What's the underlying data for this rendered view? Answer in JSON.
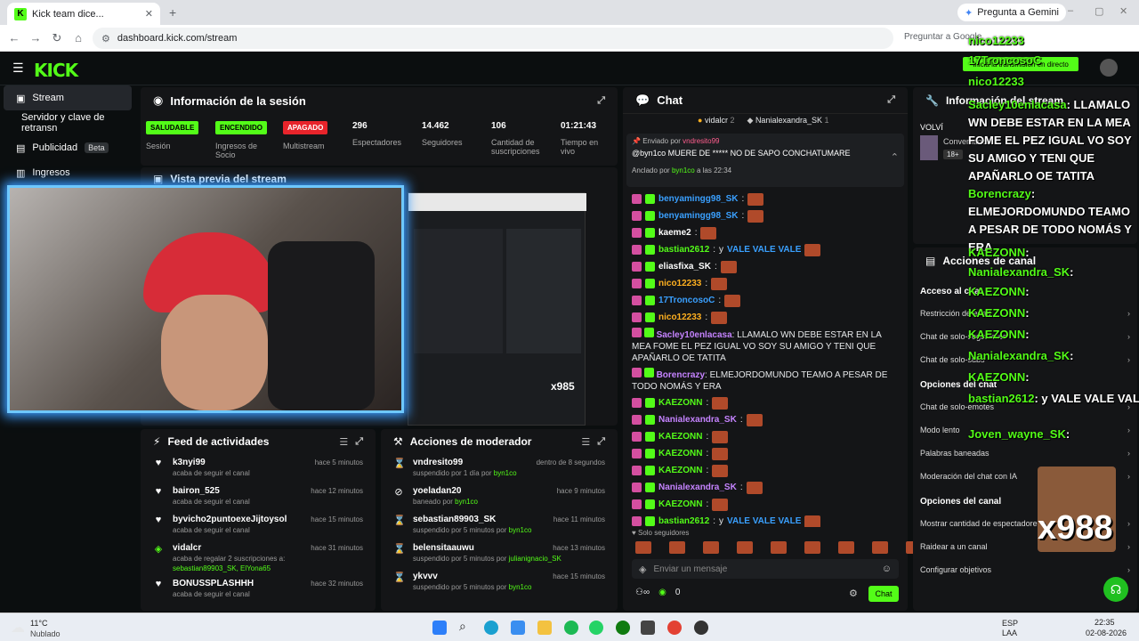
{
  "browser": {
    "tab_title": "Kick team dice...",
    "gemini": "Pregunta a Gemini",
    "url": "dashboard.kick.com/stream",
    "ask_google": "Preguntar a Google"
  },
  "sidebar": {
    "items": [
      {
        "label": "Stream"
      },
      {
        "label": "Servidor y clave de retransn"
      },
      {
        "label": "Publicidad",
        "badge": "Beta"
      },
      {
        "label": "Ingresos"
      }
    ]
  },
  "session": {
    "title": "Información de la sesión",
    "stats": [
      {
        "badge": "SALUDABLE",
        "label": "Sesión"
      },
      {
        "badge": "ENCENDIDO",
        "label": "Ingresos de Socio"
      },
      {
        "badge": "APAGADO",
        "label": "Multistream"
      },
      {
        "value": "296",
        "label": "Espectadores"
      },
      {
        "value": "14.462",
        "label": "Seguidores"
      },
      {
        "value": "106",
        "label": "Cantidad de suscripciones"
      },
      {
        "value": "01:21:43",
        "label": "Tiempo en vivo"
      }
    ]
  },
  "preview": {
    "title": "Vista previa del stream"
  },
  "feed": {
    "title": "Feed de actividades",
    "rows": [
      {
        "name": "k3nyi99",
        "sub": "acaba de seguir el canal",
        "time": "hace 5 minutos"
      },
      {
        "name": "bairon_525",
        "sub": "acaba de seguir el canal",
        "time": "hace 12 minutos"
      },
      {
        "name": "byvicho2puntoexeJijtoysol",
        "sub": "acaba de seguir el canal",
        "time": "hace 15 minutos"
      },
      {
        "name": "vidalcr",
        "sub": "acaba de regalar 2 suscripciones a:",
        "sub2": "sebastian89903_SK, ElYona65",
        "time": "hace 31 minutos"
      },
      {
        "name": "BONUSSPLASHHH",
        "sub": "acaba de seguir el canal",
        "time": "hace 32 minutos"
      }
    ]
  },
  "mod": {
    "title": "Acciones de moderador",
    "rows": [
      {
        "name": "vndresito99",
        "sub": "suspendido por 1 día por",
        "by": "byn1co",
        "time": "dentro de 8 segundos"
      },
      {
        "name": "yoeladan20",
        "sub": "baneado por",
        "by": "byn1co",
        "time": "hace 9 minutos"
      },
      {
        "name": "sebastian89903_SK",
        "sub": "suspendido por 5 minutos por",
        "by": "byn1co",
        "time": "hace 11 minutos"
      },
      {
        "name": "belensitaauwu",
        "sub": "suspendido por 5 minutos por",
        "by": "julianignacio_SK",
        "time": "hace 13 minutos"
      },
      {
        "name": "ykvvv",
        "sub": "suspendido por 5 minutos por",
        "by": "byn1co",
        "time": "hace 15 minutos"
      }
    ]
  },
  "chat": {
    "title": "Chat",
    "top_gifters": [
      {
        "name": "vidalcr",
        "count": "2"
      },
      {
        "name": "Nanialexandra_SK",
        "count": "1"
      }
    ],
    "pinned_by_label": "Enviado por",
    "pinned_by": "vndresito99",
    "pinned_msg": "@byn1co MUERE DE ***** NO DE SAPO CONCHATUMARE",
    "anchored_label": "Anclado por",
    "anchored_by": "byn1co",
    "anchored_time": "a las 22:34",
    "messages": [
      {
        "user": "benyamingg98_SK",
        "text": "",
        "color": "#3aa0ff"
      },
      {
        "user": "benyamingg98_SK",
        "text": "",
        "color": "#3aa0ff"
      },
      {
        "user": "kaeme2",
        "text": "",
        "color": "#ffffff"
      },
      {
        "user": "bastian2612",
        "text": "y",
        "vale": "VALE VALE VALE",
        "color": "#53fc18"
      },
      {
        "user": "eliasfixa_SK",
        "text": "",
        "color": "#ffffff"
      },
      {
        "user": "nico12233",
        "text": "",
        "color": "#ffb020"
      },
      {
        "user": "17TroncosoC",
        "text": "",
        "color": "#3aa0ff"
      },
      {
        "user": "nico12233",
        "text": "",
        "color": "#ffb020"
      },
      {
        "user": "Sacley10enlacasa",
        "text": "LLAMALO WN DEBE ESTAR EN LA MEA FOME EL PEZ IGUAL VO SOY SU AMIGO Y TENI QUE APAÑARLO OE TATITA",
        "color": "#c583ff"
      },
      {
        "user": "Borencrazy",
        "text": "ELMEJORDOMUNDO TEAMO A PESAR DE TODO NOMÁS Y ERA",
        "color": "#c583ff"
      },
      {
        "user": "KAEZONN",
        "text": "",
        "color": "#53fc18"
      },
      {
        "user": "Nanialexandra_SK",
        "text": "",
        "color": "#c583ff"
      },
      {
        "user": "KAEZONN",
        "text": "",
        "color": "#53fc18"
      },
      {
        "user": "KAEZONN",
        "text": "",
        "color": "#53fc18"
      },
      {
        "user": "KAEZONN",
        "text": "",
        "color": "#53fc18"
      },
      {
        "user": "Nanialexandra_SK",
        "text": "",
        "color": "#c583ff"
      },
      {
        "user": "KAEZONN",
        "text": "",
        "color": "#53fc18"
      },
      {
        "user": "bastian2612",
        "text": "y",
        "vale": "VALE VALE VALE",
        "color": "#53fc18"
      }
    ],
    "followers_only": "Solo seguidores",
    "input_placeholder": "Enviar un mensaje",
    "send_label": "Chat",
    "points": "0"
  },
  "stream_info": {
    "title": "Información del stream",
    "label": "VOLVÍ",
    "sub": "Conversando",
    "age": "18+"
  },
  "channel_actions": {
    "title": "Acciones de canal",
    "sections": [
      {
        "header": "Acceso al chat",
        "items": [
          "Restricción de edad",
          "Chat de solo-seguidores",
          "Chat de solo-subs"
        ]
      },
      {
        "header": "Opciones del chat",
        "items": [
          "Chat de solo-emotes",
          "Modo lento",
          "Palabras baneadas",
          "Moderación del chat con IA"
        ]
      },
      {
        "header": "Opciones del canal",
        "items": [
          "Mostrar cantidad de espectadores",
          "Raidear a un canal",
          "Configurar objetivos"
        ]
      }
    ]
  },
  "overlay": {
    "lines": [
      {
        "u": "nico12233",
        "m": ""
      },
      {
        "u": "17TroncosoC",
        "m": ""
      },
      {
        "u": "nico12233",
        "m": ""
      },
      {
        "u": "Sacley10enlacasa",
        "m": ": LLAMALO WN DEBE ESTAR EN LA MEA FOME EL PEZ IGUAL VO SOY SU AMIGO Y TENI QUE APAÑARLO OE TATITA"
      },
      {
        "u": "Borencrazy",
        "m": ": ELMEJORDOMUNDO TEAMO A PESAR DE TODO NOMÁS Y ERA"
      },
      {
        "u": "KAEZONN",
        "m": ":"
      },
      {
        "u": "Nanialexandra_SK",
        "m": ":"
      },
      {
        "u": "KAEZONN",
        "m": ":"
      },
      {
        "u": "KAEZONN",
        "m": ":"
      },
      {
        "u": "KAEZONN",
        "m": ":"
      },
      {
        "u": "Nanialexandra_SK",
        "m": ":"
      },
      {
        "u": "KAEZONN",
        "m": ":"
      },
      {
        "u": "bastian2612",
        "m": ": y VALE VALE VALE"
      },
      {
        "u": "Joven_wayne_SK",
        "m": ":"
      }
    ],
    "start_banner": "Inicia la transmisión en directo",
    "x_count": "x988",
    "cam_x": "x985"
  },
  "weather": {
    "temp": "11°C",
    "desc": "Nublado"
  },
  "clock": {
    "time": "22:35",
    "date": "02-08-2026",
    "lang": "ESP",
    "kb": "LAA"
  }
}
